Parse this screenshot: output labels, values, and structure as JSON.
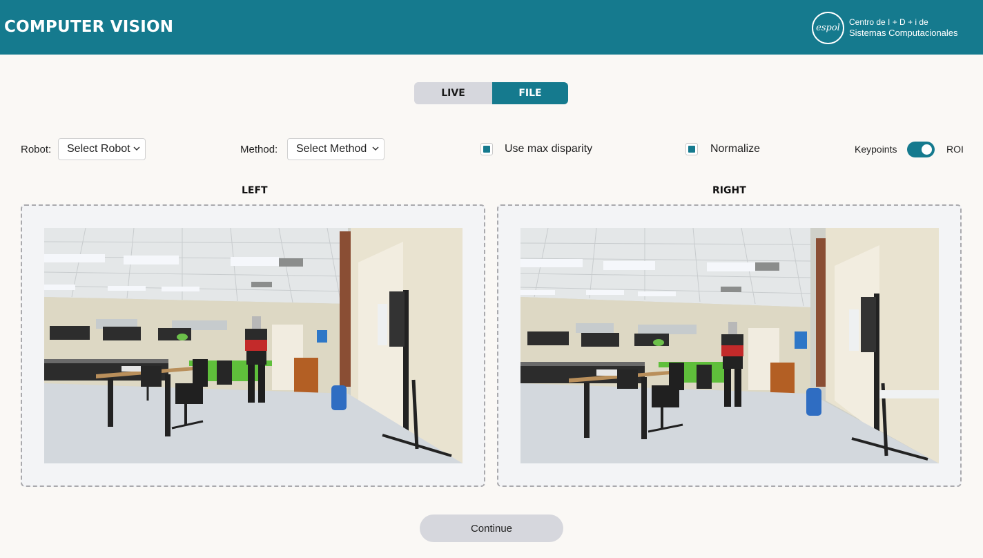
{
  "header": {
    "title": "COMPUTER VISION",
    "logo": {
      "wordmark": "espol",
      "line1": "Centro de I + D + i de",
      "line2": "Sistemas Computacionales"
    },
    "colors": {
      "brand": "#157a8e",
      "header_text": "#ffffff"
    }
  },
  "mode_toggle": {
    "options": [
      "LIVE",
      "FILE"
    ],
    "selected": "FILE"
  },
  "controls": {
    "robot": {
      "label": "Robot:",
      "value": "Select Robot"
    },
    "method": {
      "label": "Method:",
      "value": "Select Method"
    },
    "use_max_disparity": {
      "label": "Use max disparity",
      "checked": true
    },
    "normalize": {
      "label": "Normalize",
      "checked": true
    },
    "view_switch": {
      "left_label": "Keypoints",
      "right_label": "ROI",
      "on": true
    }
  },
  "panels": {
    "left": {
      "title": "LEFT",
      "image": "stereo-left-lab-photo"
    },
    "right": {
      "title": "RIGHT",
      "image": "stereo-right-lab-photo"
    }
  },
  "actions": {
    "continue_label": "Continue"
  }
}
